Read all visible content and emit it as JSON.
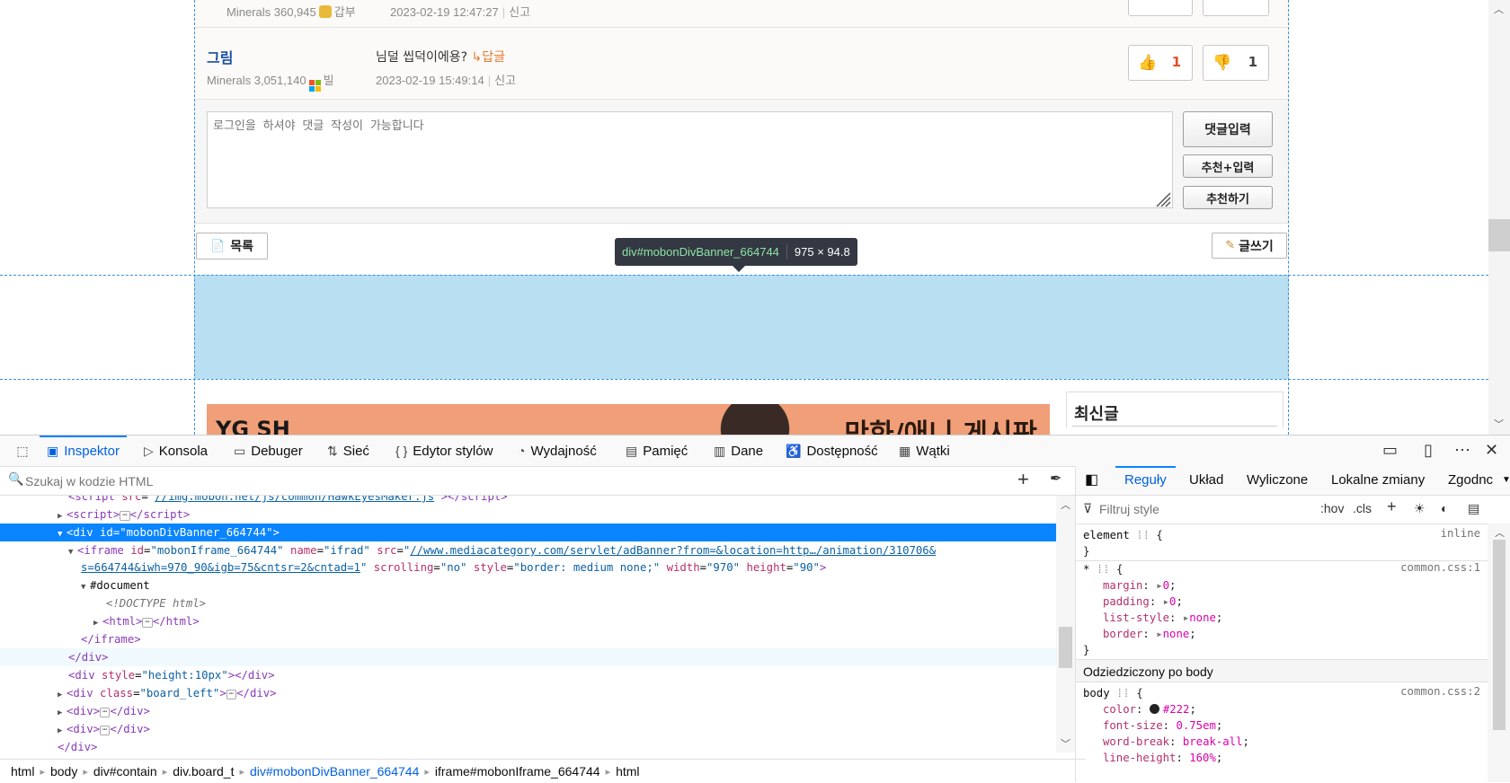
{
  "page": {
    "comment1": {
      "meta": "Minerals 360,945",
      "author": "갑부",
      "date": "2023-02-19 12:47:27",
      "report": "신고"
    },
    "comment2": {
      "author": "그림",
      "meta": "Minerals 3,051,140",
      "author_tag": "빌",
      "text": "님덜 씹덕이에용?",
      "reply": "↳답글",
      "date": "2023-02-19 15:49:14",
      "report": "신고",
      "likes": "1",
      "dislikes": "1"
    },
    "comment_form": {
      "placeholder": "로그인을 하셔야 댓글 작성이 가능합니다",
      "submit": "댓글입력",
      "recommend_submit": "추천+입력",
      "recommend": "추천하기"
    },
    "list_button": "목록",
    "write_button": "글쓰기",
    "highlight_tooltip": {
      "selector_tag": "div",
      "selector_id": "#mobonDivBanner_664744",
      "size": "975 × 94.8"
    },
    "sidebar_latest": "최신글",
    "ad": {
      "left": "YG SH",
      "right": "만화/애니 게시판"
    }
  },
  "devtools": {
    "tabs": [
      "Inspektor",
      "Konsola",
      "Debuger",
      "Sieć",
      "Edytor stylów",
      "Wydajność",
      "Pamięć",
      "Dane",
      "Dostępność",
      "Wątki"
    ],
    "search_placeholder": "Szukaj w kodzie HTML",
    "markup": {
      "l1_src": "//img.mobon.net/js/common/HawkEyesMaker.js",
      "l3_id": "mobonDivBanner_664744",
      "l4_id": "mobonIframe_664744",
      "l4_name": "ifrad",
      "l4_src1": "//www.mediacategory.com/servlet/adBanner?from=&location=http…/animation/310706&",
      "l4_src2": "s=664744&iwh=970_90&igb=75&cntsr=2&cntad=1",
      "l4_scrolling": "no",
      "l4_style": "border: medium none;",
      "l4_width": "970",
      "l4_height": "90",
      "doc": "#document",
      "doctype": "<!DOCTYPE html>",
      "style_10": "height:10px",
      "board_left": "board_left"
    },
    "breadcrumbs": [
      "html",
      "body",
      "div#contain",
      "div.board_t",
      "div#mobonDivBanner_664744",
      "iframe#mobonIframe_664744",
      "html"
    ],
    "rules_tabs": [
      "Reguły",
      "Układ",
      "Wyliczone",
      "Lokalne zmiany",
      "Zgodnc"
    ],
    "filter_placeholder": "Filtruj style",
    "hov": ":hov",
    "cls": ".cls",
    "rules": {
      "element_selector": "element",
      "element_src": "inline",
      "star_src": "common.css:1",
      "margin": "0",
      "padding": "0",
      "list_style": "none",
      "border": "none",
      "inherited_header": "Odziedziczony po body",
      "body_src": "common.css:2",
      "color": "#222",
      "font_size": "0.75em",
      "word_break": "break-all",
      "line_height": "160%"
    }
  }
}
